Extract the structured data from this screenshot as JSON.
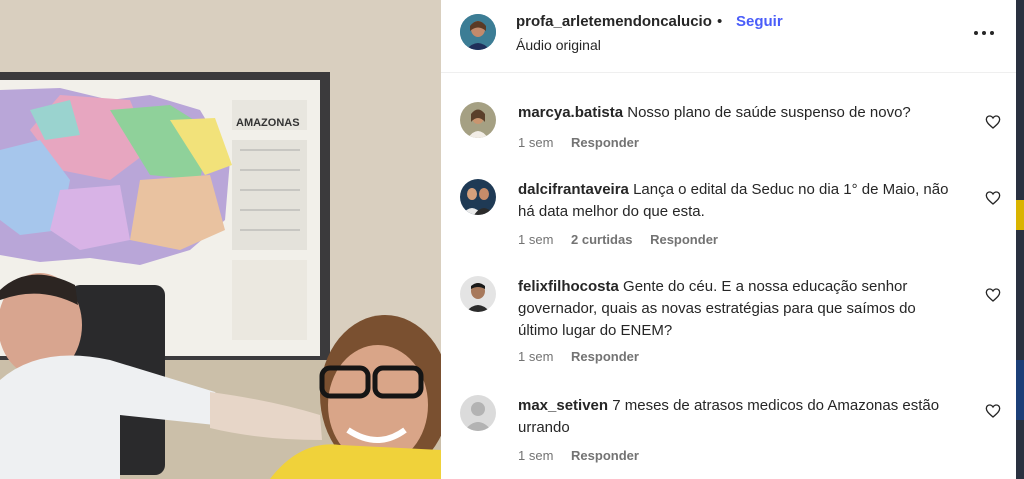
{
  "header": {
    "username": "profa_arletemendoncalucio",
    "separator": "•",
    "follow_label": "Seguir",
    "audio_label": "Áudio original"
  },
  "video": {
    "map_label": "AMAZONAS"
  },
  "colors": {
    "follow": "#4a5df9",
    "meta": "#737373",
    "text": "#262626"
  },
  "comments": [
    {
      "username": "marcya.batista",
      "text": "Nosso plano de saúde suspenso de novo?",
      "time": "1 sem",
      "likes": "",
      "reply_label": "Responder"
    },
    {
      "username": "dalcifrantaveira",
      "text": "Lança o edital da Seduc no dia 1° de Maio, não há data melhor do que esta.",
      "time": "1 sem",
      "likes": "2 curtidas",
      "reply_label": "Responder"
    },
    {
      "username": "felixfilhocosta",
      "text": "Gente do céu. E a nossa educação senhor governador, quais as novas estratégias para que saímos do último lugar do ENEM?",
      "time": "1 sem",
      "likes": "",
      "reply_label": "Responder"
    },
    {
      "username": "max_setiven",
      "text": "7 meses de atrasos medicos do Amazonas estão urrando",
      "time": "1 sem",
      "likes": "",
      "reply_label": "Responder"
    }
  ]
}
